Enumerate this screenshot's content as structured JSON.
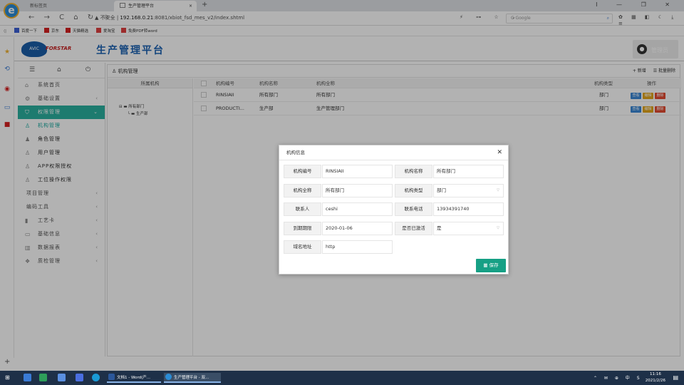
{
  "browser": {
    "tabs": [
      {
        "label": "新标签页"
      },
      {
        "label": "生产管理平台",
        "close": "×"
      }
    ],
    "newtab": "+",
    "window_controls": "ⵏ — ❐ ✕",
    "nav": "← → C ⌂ ↻ ☆",
    "url_warning": "▲ 不安全",
    "url_host": "192.168.0.21",
    "url_path": ":8081/xbiot_fsd_mes_v2/index.shtml",
    "addr_icons": "⚡ ⊶ ☆ ⌄",
    "search_placeholder": "G Google",
    "ext_icons": "✿ ▦ ◧ ☾ ⤓ ≡",
    "bookmarks": [
      "百度一下",
      "京东",
      "天猫精选",
      "爱淘宝",
      "免费PDF转word"
    ]
  },
  "app": {
    "brand_abbr": "AVIC",
    "brand_name": "FORSTAR",
    "title": "生产管理平台",
    "user_initial": "●",
    "username": "管理员"
  },
  "menu": {
    "top_icons": [
      "☰",
      "⌂",
      "⏻"
    ],
    "items": [
      {
        "label": "系统首页",
        "icon": "⌂",
        "type": "top"
      },
      {
        "label": "基础设置",
        "icon": "⚙",
        "type": "top",
        "arrow": "‹"
      },
      {
        "label": "权限管理",
        "icon": "⛉",
        "type": "active",
        "arrow": "⌄"
      },
      {
        "label": "机构管理",
        "icon": "♙",
        "type": "sub-current"
      },
      {
        "label": "角色管理",
        "icon": "♟",
        "type": "sub"
      },
      {
        "label": "用户管理",
        "icon": "♙",
        "type": "sub"
      },
      {
        "label": "APP权限授权",
        "icon": "♙",
        "type": "sub"
      },
      {
        "label": "工位操作权限",
        "icon": "♙",
        "type": "sub"
      },
      {
        "label": "项目管理",
        "type": "plain",
        "arrow": "‹"
      },
      {
        "label": "编码工具",
        "type": "plain",
        "arrow": "‹"
      },
      {
        "label": "工艺卡",
        "icon": "▮",
        "type": "top",
        "arrow": "‹"
      },
      {
        "label": "基础信息",
        "icon": "▭",
        "type": "top",
        "arrow": "‹"
      },
      {
        "label": "数据报表",
        "icon": "▥",
        "type": "top",
        "arrow": "‹"
      },
      {
        "label": "质检管理",
        "icon": "❖",
        "type": "top",
        "arrow": "‹"
      }
    ]
  },
  "content": {
    "breadcrumb_icon": "♙",
    "breadcrumb": "机构管理",
    "add_label": "+ 新增",
    "batch_delete_label": "☰ 批量删除",
    "tree_header": "所属机构",
    "tree": [
      {
        "label": "⊟ ▬ 所有部门"
      },
      {
        "label": "└ ▬ 生产部"
      }
    ],
    "columns": [
      "机构编号",
      "机构名称",
      "机构全称",
      "机构类型",
      "操作"
    ],
    "rows": [
      {
        "code": "RINSIAII",
        "name": "所有部门",
        "full": "所有部门",
        "type": "部门"
      },
      {
        "code": "PRODUCTI...",
        "name": "生产部",
        "full": "生产管理部门",
        "type": "部门"
      }
    ],
    "row_actions": {
      "view": "查看",
      "edit": "编辑",
      "delete": "删除"
    }
  },
  "modal": {
    "title": "机构信息",
    "close": "✕",
    "fields": {
      "code": {
        "label": "机构编号",
        "value": "RINSIAII"
      },
      "name": {
        "label": "机构名称",
        "value": "所有部门"
      },
      "full": {
        "label": "机构全称",
        "value": "所有部门"
      },
      "type": {
        "label": "机构类型",
        "value": "部门"
      },
      "contact": {
        "label": "联系人",
        "value": "ceshi"
      },
      "phone": {
        "label": "联系电话",
        "value": "13934391740"
      },
      "expiry": {
        "label": "到期期限",
        "value": "2020-01-06"
      },
      "enabled": {
        "label": "是否已激活",
        "value": "是"
      },
      "domain": {
        "label": "域名地址",
        "value": "http"
      }
    },
    "dropdown_arrow": "▽",
    "save_label": "▦ 保存"
  },
  "taskbar": {
    "task1": "文档1 - Word(产...",
    "task2": "生产管理平台 - 双...",
    "time": "11:16",
    "date": "2021/2/26",
    "tray": "⌃ ✉ ⊕ 中 S",
    "notif": "▤"
  },
  "colors": {
    "accent": "#2ab0a0",
    "title_blue": "#1e63b4",
    "view": "#3a87d6",
    "edit": "#e3a51a",
    "delete": "#e24a30",
    "save": "#16a085"
  }
}
